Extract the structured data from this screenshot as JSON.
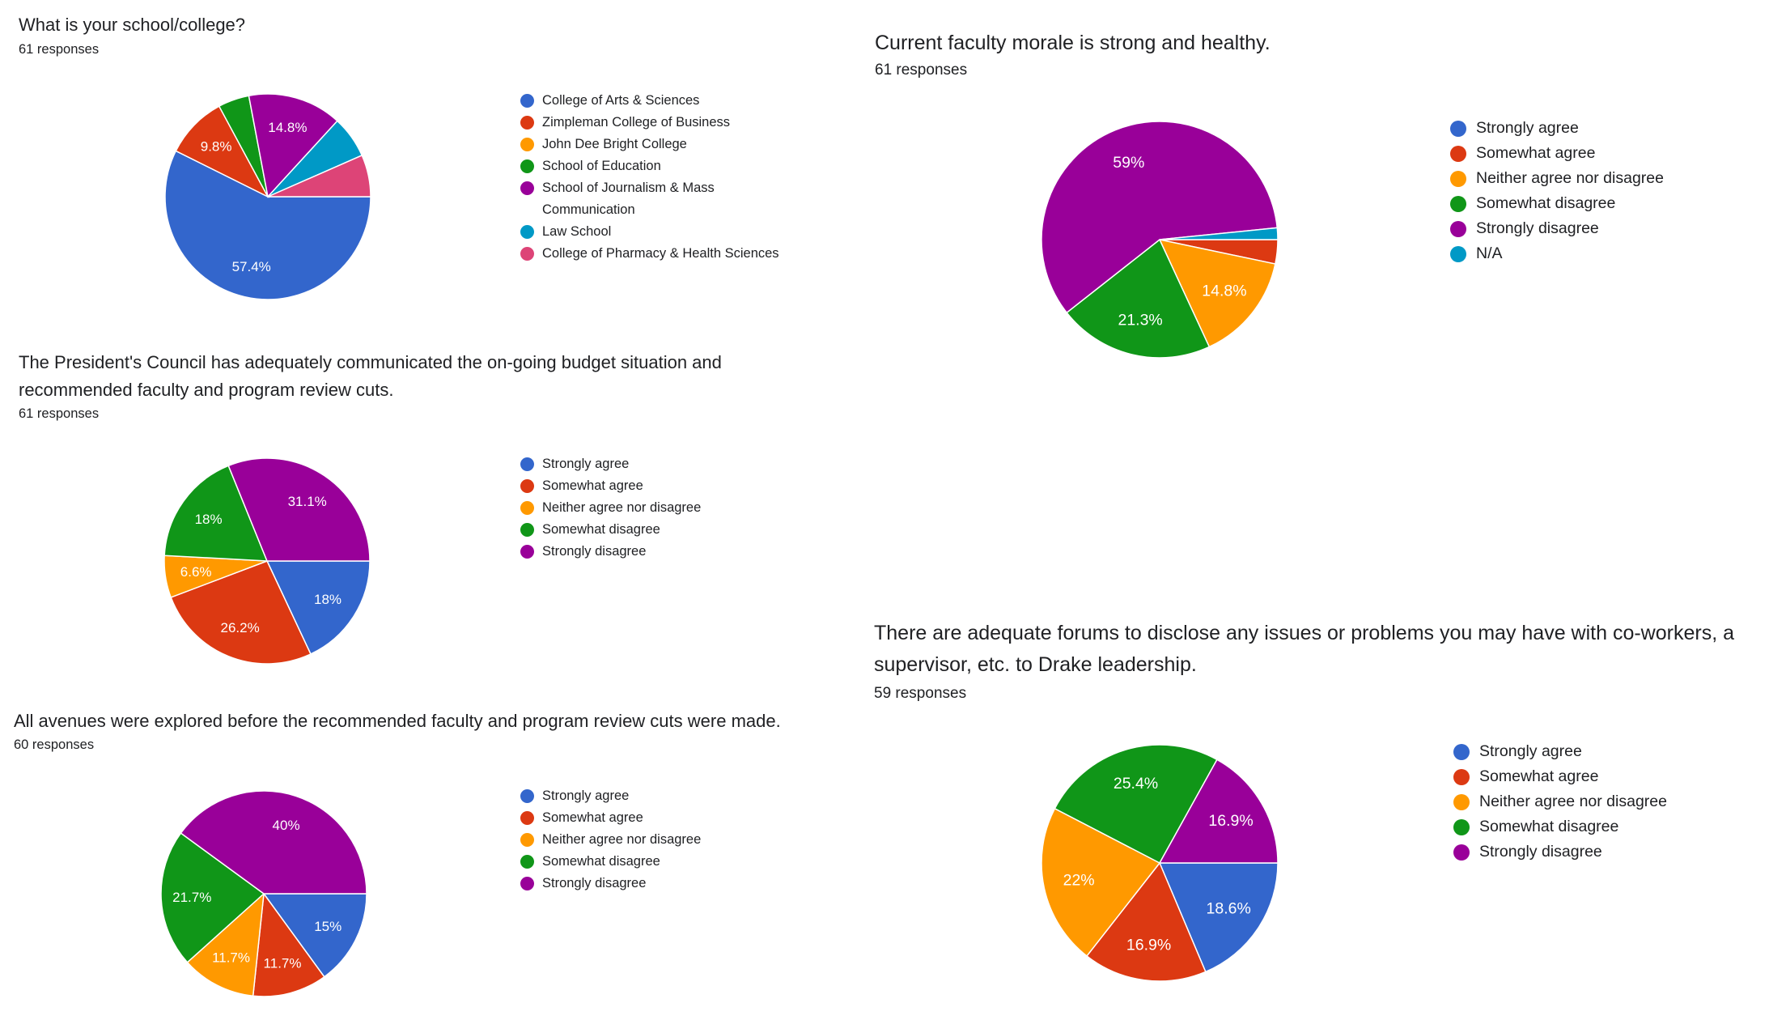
{
  "colors": {
    "blue": "#3366cc",
    "red": "#dc3912",
    "orange": "#ff9900",
    "green": "#109618",
    "purple": "#990099",
    "cyan": "#0099c6",
    "pink": "#dd4477"
  },
  "chart_data": [
    {
      "id": "school",
      "type": "pie",
      "title": "What is your school/college?",
      "responses": "61 responses",
      "start_angle": "3 o'clock, clockwise",
      "categories": [
        "College of Arts & Sciences",
        "Zimpleman College of Business",
        "John Dee Bright College",
        "School of Education",
        "School of Journalism & Mass Communication",
        "Law School",
        "College of Pharmacy & Health Sciences"
      ],
      "values": [
        57.4,
        9.8,
        0,
        4.9,
        14.8,
        6.6,
        6.6
      ],
      "data_labels": [
        "57.4%",
        "9.8%",
        "",
        "",
        "14.8%",
        "",
        ""
      ],
      "series_colors": [
        "#3366cc",
        "#dc3912",
        "#ff9900",
        "#109618",
        "#990099",
        "#0099c6",
        "#dd4477"
      ],
      "legend": "right"
    },
    {
      "id": "presidents-council",
      "type": "pie",
      "title": "The President's Council has adequately communicated the on-going budget situation and recommended faculty and program review cuts.",
      "title_lines": [
        "The President's Council has adequately communicated the on-going budget situation and",
        "recommended faculty and program review cuts."
      ],
      "responses": "61 responses",
      "categories": [
        "Strongly agree",
        "Somewhat agree",
        "Neither agree nor disagree",
        "Somewhat disagree",
        "Strongly disagree"
      ],
      "values": [
        18,
        26.2,
        6.6,
        18,
        31.1
      ],
      "data_labels": [
        "18%",
        "26.2%",
        "6.6%",
        "18%",
        "31.1%"
      ],
      "series_colors": [
        "#3366cc",
        "#dc3912",
        "#ff9900",
        "#109618",
        "#990099"
      ],
      "legend": "right"
    },
    {
      "id": "all-avenues",
      "type": "pie",
      "title": "All avenues were explored before the recommended faculty and program review cuts were made.",
      "responses": "60 responses",
      "categories": [
        "Strongly agree",
        "Somewhat agree",
        "Neither agree nor disagree",
        "Somewhat disagree",
        "Strongly disagree"
      ],
      "values": [
        15,
        11.7,
        11.7,
        21.7,
        40
      ],
      "data_labels": [
        "15%",
        "11.7%",
        "11.7%",
        "21.7%",
        "40%"
      ],
      "series_colors": [
        "#3366cc",
        "#dc3912",
        "#ff9900",
        "#109618",
        "#990099"
      ],
      "legend": "right"
    },
    {
      "id": "faculty-morale",
      "type": "pie",
      "title": "Current faculty morale is strong and healthy.",
      "responses": "61 responses",
      "categories": [
        "Strongly agree",
        "Somewhat agree",
        "Neither agree nor disagree",
        "Somewhat disagree",
        "Strongly disagree",
        "N/A"
      ],
      "values": [
        0,
        3.3,
        14.8,
        21.3,
        59,
        1.6
      ],
      "data_labels": [
        "",
        "",
        "14.8%",
        "21.3%",
        "59%",
        ""
      ],
      "series_colors": [
        "#3366cc",
        "#dc3912",
        "#ff9900",
        "#109618",
        "#990099",
        "#0099c6"
      ],
      "legend": "right"
    },
    {
      "id": "adequate-forums",
      "type": "pie",
      "title": "There are adequate forums to disclose any issues or problems you may have with co-workers, a supervisor, etc. to Drake leadership.",
      "title_lines": [
        "There are adequate forums to disclose any issues or problems you may have with co-workers, a",
        "supervisor, etc. to Drake leadership."
      ],
      "responses": "59 responses",
      "categories": [
        "Strongly agree",
        "Somewhat agree",
        "Neither agree nor disagree",
        "Somewhat disagree",
        "Strongly disagree"
      ],
      "values": [
        18.6,
        16.9,
        22,
        25.4,
        16.9
      ],
      "data_labels": [
        "18.6%",
        "16.9%",
        "22%",
        "25.4%",
        "16.9%"
      ],
      "series_colors": [
        "#3366cc",
        "#dc3912",
        "#ff9900",
        "#109618",
        "#990099"
      ],
      "legend": "right"
    }
  ]
}
